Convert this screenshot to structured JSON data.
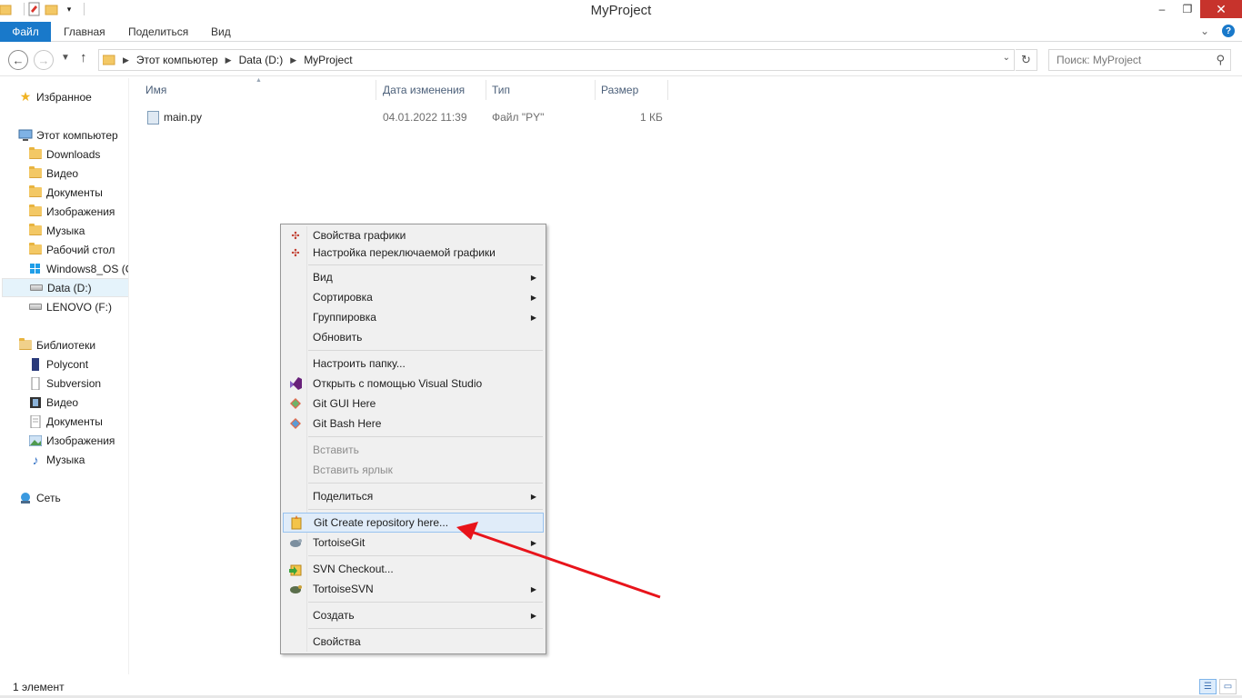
{
  "window": {
    "title": "MyProject"
  },
  "window_controls": {
    "minimize": "‒",
    "restore": "❐",
    "close": "✕"
  },
  "ribbon": {
    "tabs": [
      "Файл",
      "Главная",
      "Поделиться",
      "Вид"
    ]
  },
  "address": {
    "crumbs": [
      "Этот компьютер",
      "Data (D:)",
      "MyProject"
    ],
    "search_placeholder": "Поиск: MyProject"
  },
  "nav_pane": {
    "favorites": "Избранное",
    "computer": "Этот компьютер",
    "computer_items": [
      "Downloads",
      "Видео",
      "Документы",
      "Изображения",
      "Музыка",
      "Рабочий стол",
      "Windows8_OS (C",
      "Data (D:)",
      "LENOVO (F:)"
    ],
    "libraries": "Библиотеки",
    "library_items": [
      "Polycont",
      "Subversion",
      "Видео",
      "Документы",
      "Изображения",
      "Музыка"
    ],
    "network": "Сеть",
    "selected": "Data (D:)"
  },
  "file_list": {
    "columns": [
      "Имя",
      "Дата изменения",
      "Тип",
      "Размер"
    ],
    "rows": [
      {
        "name": "main.py",
        "modified": "04.01.2022 11:39",
        "type": "Файл \"PY\"",
        "size": "1 КБ"
      }
    ]
  },
  "context_menu": {
    "items": [
      {
        "label": "Свойства графики",
        "icon": "intel-graphics-icon"
      },
      {
        "label": "Настройка переключаемой графики",
        "icon": "intel-graphics-icon"
      },
      {
        "label": "Вид",
        "submenu": true
      },
      {
        "label": "Сортировка",
        "submenu": true
      },
      {
        "label": "Группировка",
        "submenu": true
      },
      {
        "label": "Обновить"
      },
      {
        "label": "Настроить папку..."
      },
      {
        "label": "Открыть с помощью Visual Studio",
        "icon": "visual-studio-icon"
      },
      {
        "label": "Git GUI Here",
        "icon": "git-icon"
      },
      {
        "label": "Git Bash Here",
        "icon": "git-icon"
      },
      {
        "label": "Вставить",
        "disabled": true
      },
      {
        "label": "Вставить ярлык",
        "disabled": true
      },
      {
        "label": "Поделиться",
        "submenu": true
      },
      {
        "label": "Git Create repository here...",
        "icon": "tortoisegit-create-repo-icon",
        "highlighted": true
      },
      {
        "label": "TortoiseGit",
        "icon": "tortoisegit-icon",
        "submenu": true
      },
      {
        "label": "SVN Checkout...",
        "icon": "svn-checkout-icon"
      },
      {
        "label": "TortoiseSVN",
        "icon": "tortoisesvn-icon",
        "submenu": true
      },
      {
        "label": "Создать",
        "submenu": true
      },
      {
        "label": "Свойства"
      }
    ]
  },
  "status_bar": {
    "count": "1 элемент"
  },
  "colors": {
    "accent": "#1979ca",
    "annotation_arrow": "#e8141b",
    "highlight": "#e0ecf9"
  }
}
